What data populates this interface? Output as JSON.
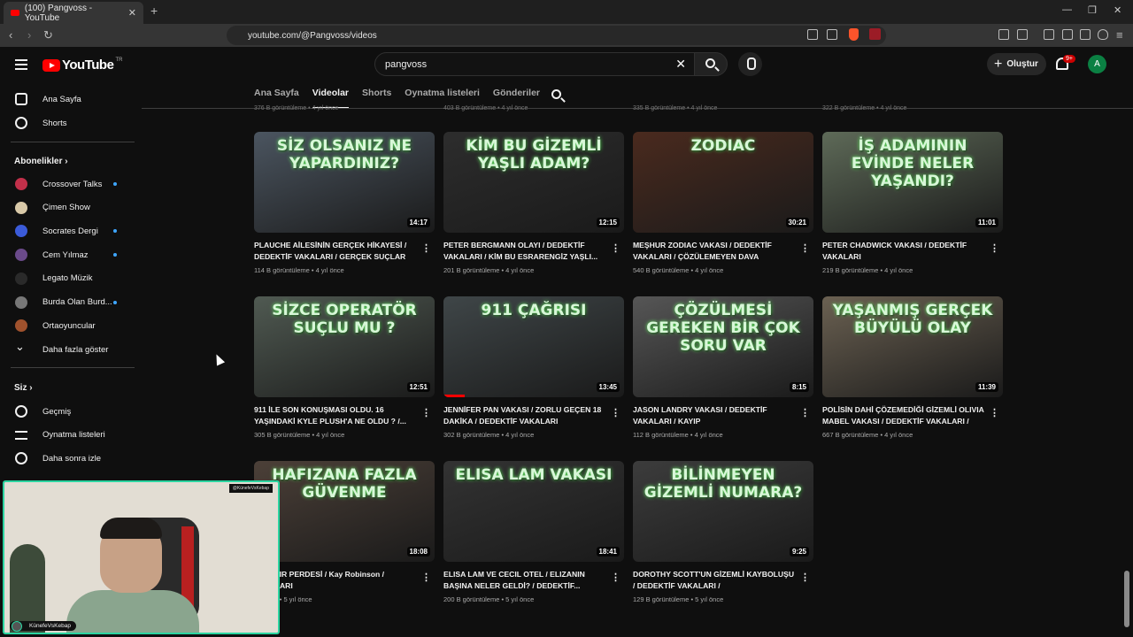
{
  "browser": {
    "tab_title": "(100) Pangvoss - YouTube",
    "url": "youtube.com/@Pangvoss/videos",
    "brave_badge": "77"
  },
  "header": {
    "logo_text": "YouTube",
    "logo_country": "TR",
    "search_value": "pangvoss",
    "create_label": "Oluştur",
    "notif_badge": "9+",
    "avatar_letter": "A"
  },
  "sidebar": {
    "main": [
      {
        "label": "Ana Sayfa",
        "icon": "home-icon"
      },
      {
        "label": "Shorts",
        "icon": "shorts-icon"
      }
    ],
    "subs_heading": "Abonelikler",
    "subs": [
      {
        "label": "Crossover Talks",
        "color": "#c2304a",
        "dot": true
      },
      {
        "label": "Çimen Show",
        "color": "#d9c9a8",
        "dot": false
      },
      {
        "label": "Socrates Dergi",
        "color": "#3b5bd9",
        "dot": true
      },
      {
        "label": "Cem Yılmaz",
        "color": "#6a4a8a",
        "dot": true
      },
      {
        "label": "Legato Müzik",
        "color": "#2a2a2a",
        "dot": false
      },
      {
        "label": "Burda Olan Burd...",
        "color": "#777777",
        "dot": true
      },
      {
        "label": "Ortaoyuncular",
        "color": "#a0522d",
        "dot": false
      }
    ],
    "more_label": "Daha fazla göster",
    "you_heading": "Siz",
    "you_items": [
      {
        "label": "Geçmiş",
        "icon": "history-icon"
      },
      {
        "label": "Oynatma listeleri",
        "icon": "playlists-icon"
      },
      {
        "label": "Daha sonra izle",
        "icon": "watch-later-icon"
      }
    ]
  },
  "channel_tabs": [
    "Ana Sayfa",
    "Videolar",
    "Shorts",
    "Oynatma listeleri",
    "Gönderiler"
  ],
  "active_tab": "Videolar",
  "top_row_partial": [
    "376 B görüntüleme • 4 yıl önce",
    "403 B görüntüleme • 4 yıl önce",
    "335 B görüntüleme • 4 yıl önce",
    "322 B görüntüleme • 4 yıl önce"
  ],
  "videos": [
    {
      "thumb_text": "SİZ OLSANIZ NE YAPARDINIZ?",
      "duration": "14:17",
      "title": "PLAUCHE AİLESİNİN GERÇEK HİKAYESİ / DEDEKTİF VAKALARI / GERÇEK SUÇLAR",
      "meta": "114 B görüntüleme • 4 yıl önce",
      "bg": "#4b5560"
    },
    {
      "thumb_text": "KİM BU GİZEMLİ YAŞLI ADAM?",
      "duration": "12:15",
      "title": "PETER BERGMANN OLAYI / DEDEKTİF VAKALARI / KİM BU ESRARENGİZ YAŞLI...",
      "meta": "201 B görüntüleme • 4 yıl önce",
      "bg": "#2d2d2d"
    },
    {
      "thumb_text": "ZODIAC",
      "duration": "30:21",
      "title": "MEŞHUR ZODIAC VAKASI / DEDEKTİF VAKALARI / ÇÖZÜLEMEYEN DAVA",
      "meta": "540 B görüntüleme • 4 yıl önce",
      "bg": "#4a2a1e"
    },
    {
      "thumb_text": "İŞ ADAMININ EVİNDE NELER YAŞANDI?",
      "duration": "11:01",
      "title": "PETER CHADWICK VAKASI / DEDEKTİF VAKALARI",
      "meta": "219 B görüntüleme • 4 yıl önce",
      "bg": "#5e6a58"
    },
    {
      "thumb_text": "SİZCE OPERATÖR SUÇLU MU ?",
      "duration": "12:51",
      "title": "911 İLE SON KONUŞMASI OLDU. 16 YAŞINDAKİ KYLE PLUSH'A NE OLDU ? /...",
      "meta": "305 B görüntüleme • 4 yıl önce",
      "bg": "#505a52"
    },
    {
      "thumb_text": "911 ÇAĞRISI",
      "duration": "13:45",
      "title": "JENNİFER PAN VAKASI / ZORLU GEÇEN 18 DAKİKA / DEDEKTİF VAKALARI",
      "meta": "302 B görüntüleme • 4 yıl önce",
      "bg": "#3f4648"
    },
    {
      "thumb_text": "ÇÖZÜLMESİ GEREKEN BİR ÇOK SORU VAR",
      "duration": "8:15",
      "title": "JASON LANDRY VAKASI / DEDEKTİF VAKALARI / KAYIP",
      "meta": "112 B görüntüleme • 4 yıl önce",
      "bg": "#565656"
    },
    {
      "thumb_text": "YAŞANMIŞ GERÇEK BÜYÜLÜ OLAY",
      "duration": "11:39",
      "title": "POLİSİN DAHİ ÇÖZEMEDİĞİ GİZEMLİ OLIVIA MABEL VAKASI / DEDEKTİF VAKALARI /",
      "meta": "667 B görüntüleme • 4 yıl önce",
      "bg": "#6b6152"
    },
    {
      "thumb_text": "HAFIZANA FAZLA GÜVENME",
      "duration": "18:08",
      "title": "İREN SIR PERDESİ / Kay Robinson / VAKALARI",
      "meta": "ntüleme • 5 yıl önce",
      "bg": "#4c4038"
    },
    {
      "thumb_text": "ELISA LAM VAKASI",
      "duration": "18:41",
      "title": "ELISA LAM VE CECIL OTEL / ELIZANIN BAŞINA NELER GELDİ? / DEDEKTİF...",
      "meta": "200 B görüntüleme • 5 yıl önce",
      "bg": "#333333"
    },
    {
      "thumb_text": "BİLİNMEYEN GİZEMLİ NUMARA?",
      "duration": "9:25",
      "title": "DOROTHY SCOTT'UN GİZEMLİ KAYBOLUŞU / DEDEKTİF VAKALARI /",
      "meta": "129 B görüntüleme • 5 yıl önce",
      "bg": "#3c3c3c"
    }
  ],
  "webcam": {
    "tag": "@KünefeVsKebap",
    "name": "KünefeVsKebap"
  }
}
